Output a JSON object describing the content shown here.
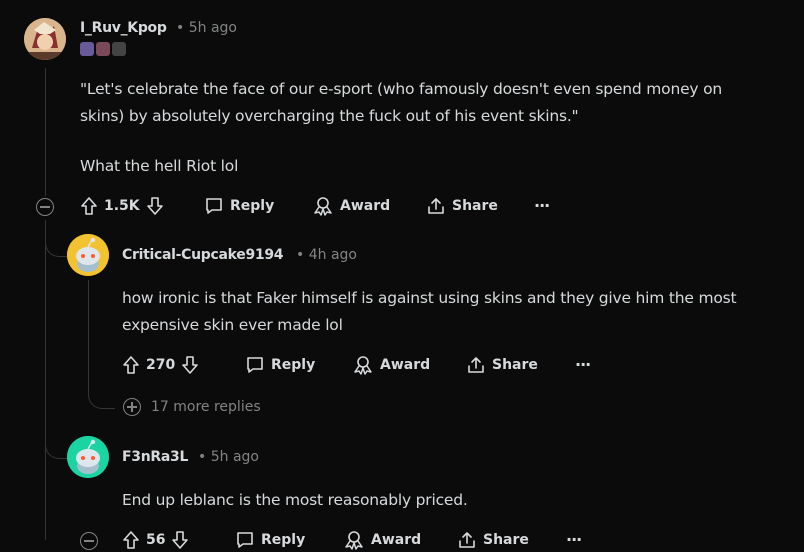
{
  "comments": [
    {
      "username": "I_Ruv_Kpop",
      "time": "5h ago",
      "body": [
        "\"Let's celebrate the face of our e-sport (who famously doesn't even spend money on",
        "skins) by absolutely overcharging the fuck out of his event skins.\"",
        "",
        "What the hell Riot lol"
      ],
      "votes": "1.5K"
    },
    {
      "username": "Critical-Cupcake9194",
      "time": "4h ago",
      "body": [
        "how ironic is that Faker himself is against using skins and they give him the most",
        "expensive skin ever made lol"
      ],
      "votes": "270",
      "more_replies": "17 more replies"
    },
    {
      "username": "F3nRa3L",
      "time": "5h ago",
      "body": [
        "End up leblanc is the most reasonably priced."
      ],
      "votes": "56"
    }
  ],
  "actions": {
    "reply": "Reply",
    "award": "Award",
    "share": "Share",
    "more": "···"
  },
  "separator": "•",
  "colors": {
    "background": "#0b0b0b",
    "text": "#d7dadc",
    "muted": "#818384",
    "avatar_yellow": "#f2c230",
    "avatar_teal": "#1ad4a2"
  }
}
